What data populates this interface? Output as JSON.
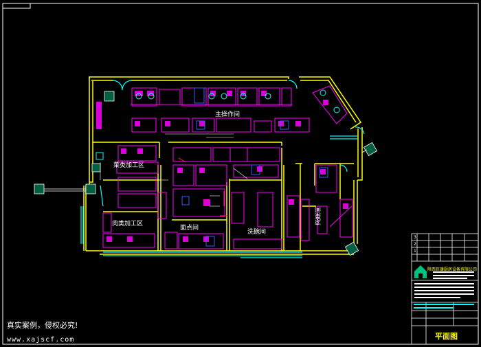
{
  "rooms": {
    "main_operation": "主操作间",
    "veg_processing": "菜类加工区",
    "meat_processing": "肉类加工区",
    "pastry": "面点间",
    "washing": "洗碗间",
    "cold_dish": "凉菜间"
  },
  "watermark": "真实案例，侵权必究!",
  "website": "www.xajscf.com",
  "title_block": {
    "drawing_title": "平面图",
    "company": "陕西巨康厨房设备有限公司",
    "rev_numbers": [
      "3",
      "2",
      "1"
    ]
  },
  "colors": {
    "background": "#000000",
    "wall": "#ffff00",
    "equipment": "#ff00ff",
    "glass": "#00ffff",
    "frame": "#ffffff",
    "fixture": "#0000ff"
  }
}
